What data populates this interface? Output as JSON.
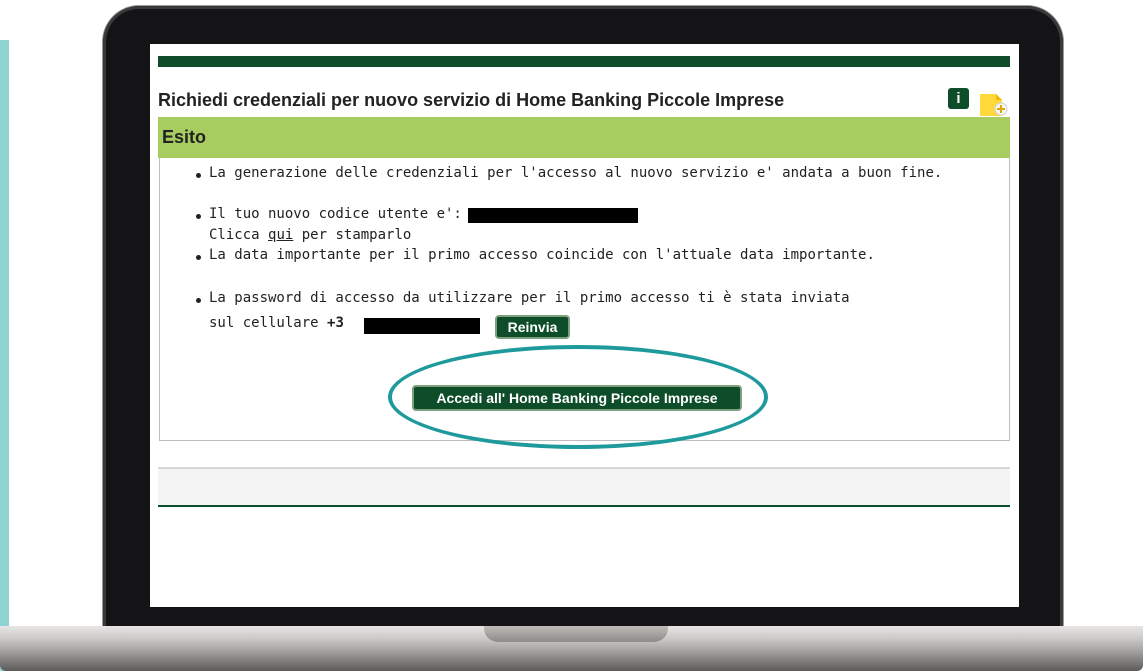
{
  "page": {
    "title": "Richiedi credenziali per nuovo servizio di Home Banking Piccole Imprese",
    "info_icon": "i",
    "icons": [
      "info-icon",
      "add-note-icon"
    ]
  },
  "esito": {
    "heading": "Esito",
    "line1": "La generazione delle credenziali per l'accesso al nuovo servizio e' andata a buon fine.",
    "line2": "Il tuo nuovo codice utente e':",
    "line3_pre": "Clicca ",
    "line3_link": "qui",
    "line3_post": " per stamparlo",
    "line4": "La data importante per il primo accesso coincide con l'attuale data importante.",
    "line5": "La password di accesso da utilizzare per il primo accesso ti è stata inviata",
    "line6_pre": "sul cellulare ",
    "phone_prefix": "+3",
    "resend_button": "Reinvia",
    "access_button": "Accedi all' Home Banking Piccole Imprese"
  },
  "colors": {
    "brand_green": "#0e4d2a",
    "esito_green": "#a7cd61",
    "highlight_oval": "#1e9a9c"
  }
}
